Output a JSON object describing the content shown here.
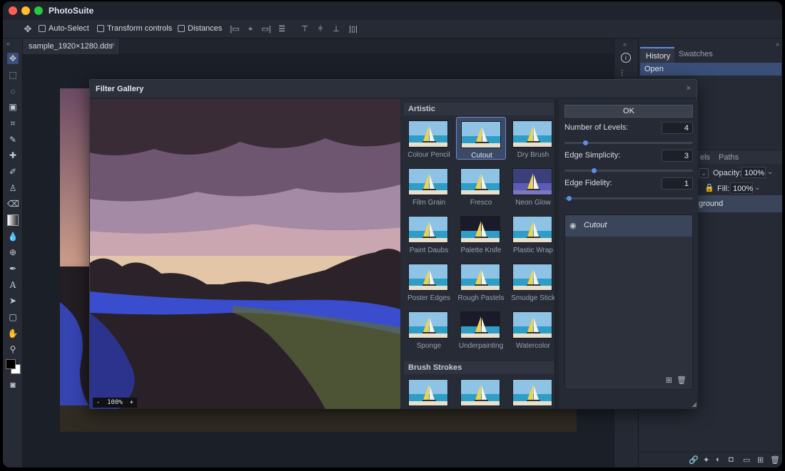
{
  "app": {
    "title": "PhotoSuite"
  },
  "options": {
    "auto_select": "Auto-Select",
    "transform_controls": "Transform controls",
    "distances": "Distances"
  },
  "document": {
    "tab": "sample_1920×1280.dds"
  },
  "panel": {
    "tabs": [
      "History",
      "Swatches"
    ],
    "history_items": [
      "Open"
    ],
    "layer_tabs": [
      "els",
      "Paths"
    ],
    "opacity_label": "Opacity:",
    "opacity": "100%",
    "fill_label": "Fill:",
    "fill": "100%",
    "layer_name": "ground"
  },
  "dialog": {
    "title": "Filter Gallery",
    "zoom": {
      "minus": "-",
      "value": "100%",
      "plus": "+"
    },
    "ok": "OK",
    "categories": [
      {
        "name": "Artistic",
        "filters": [
          "Colour Pencil",
          "Cutout",
          "Dry Brush",
          "Film Grain",
          "Fresco",
          "Neon Glow",
          "Paint Daubs",
          "Palette Knife",
          "Plastic Wrap",
          "Poster Edges",
          "Rough Pastels",
          "Smudge Stick",
          "Sponge",
          "Underpainting",
          "Watercolor"
        ]
      },
      {
        "name": "Brush Strokes",
        "filters": [
          "",
          "",
          ""
        ]
      }
    ],
    "selected_filter": "Cutout",
    "params": [
      {
        "label": "Number of Levels:",
        "value": "4",
        "level": 0.15
      },
      {
        "label": "Edge Simplicity:",
        "value": "3",
        "level": 0.22
      },
      {
        "label": "Edge Fidelity:",
        "value": "1",
        "level": 0.02
      }
    ],
    "effect_layer": "Cutout"
  },
  "colors": {
    "accent": "#5c8ee6",
    "selected_tab": "#3a4f78"
  }
}
